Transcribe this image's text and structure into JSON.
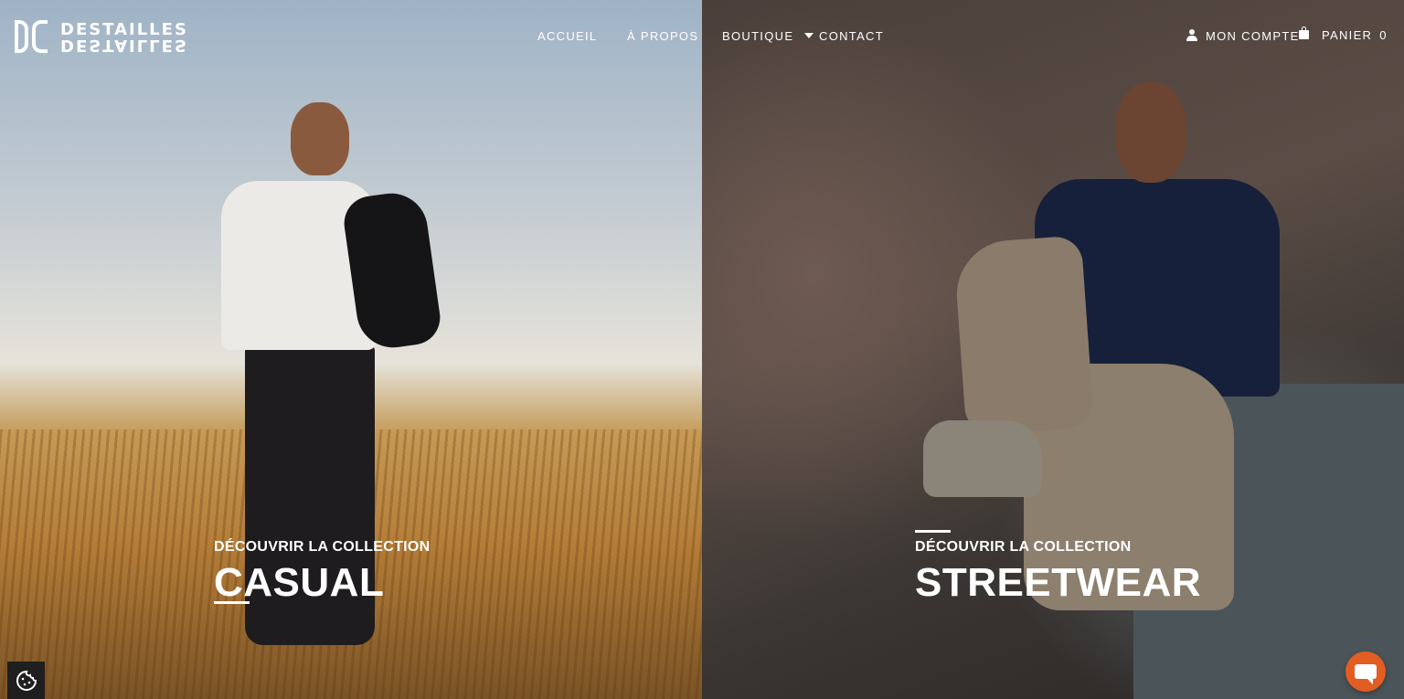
{
  "brand": {
    "logo_text": "DESTAILLES",
    "logo_text_mirrored": "DESTAILLES"
  },
  "nav": {
    "items": [
      {
        "label": "ACCUEIL"
      },
      {
        "label": "À PROPOS"
      },
      {
        "label": "BOUTIQUE"
      },
      {
        "label": "CONTACT"
      }
    ]
  },
  "account": {
    "label": "MON COMPTE",
    "icon": "user-icon"
  },
  "cart": {
    "label": "PANIER",
    "count": "0",
    "icon": "shopping-bag-icon"
  },
  "collections": [
    {
      "kicker": "DÉCOUVRIR LA COLLECTION",
      "title": "CASUAL"
    },
    {
      "kicker": "DÉCOUVRIR LA COLLECTION",
      "title": "STREETWEAR"
    }
  ],
  "widgets": {
    "cookie_icon": "cookie-icon",
    "chat_icon": "chat-icon",
    "chat_color": "#e15d21"
  }
}
